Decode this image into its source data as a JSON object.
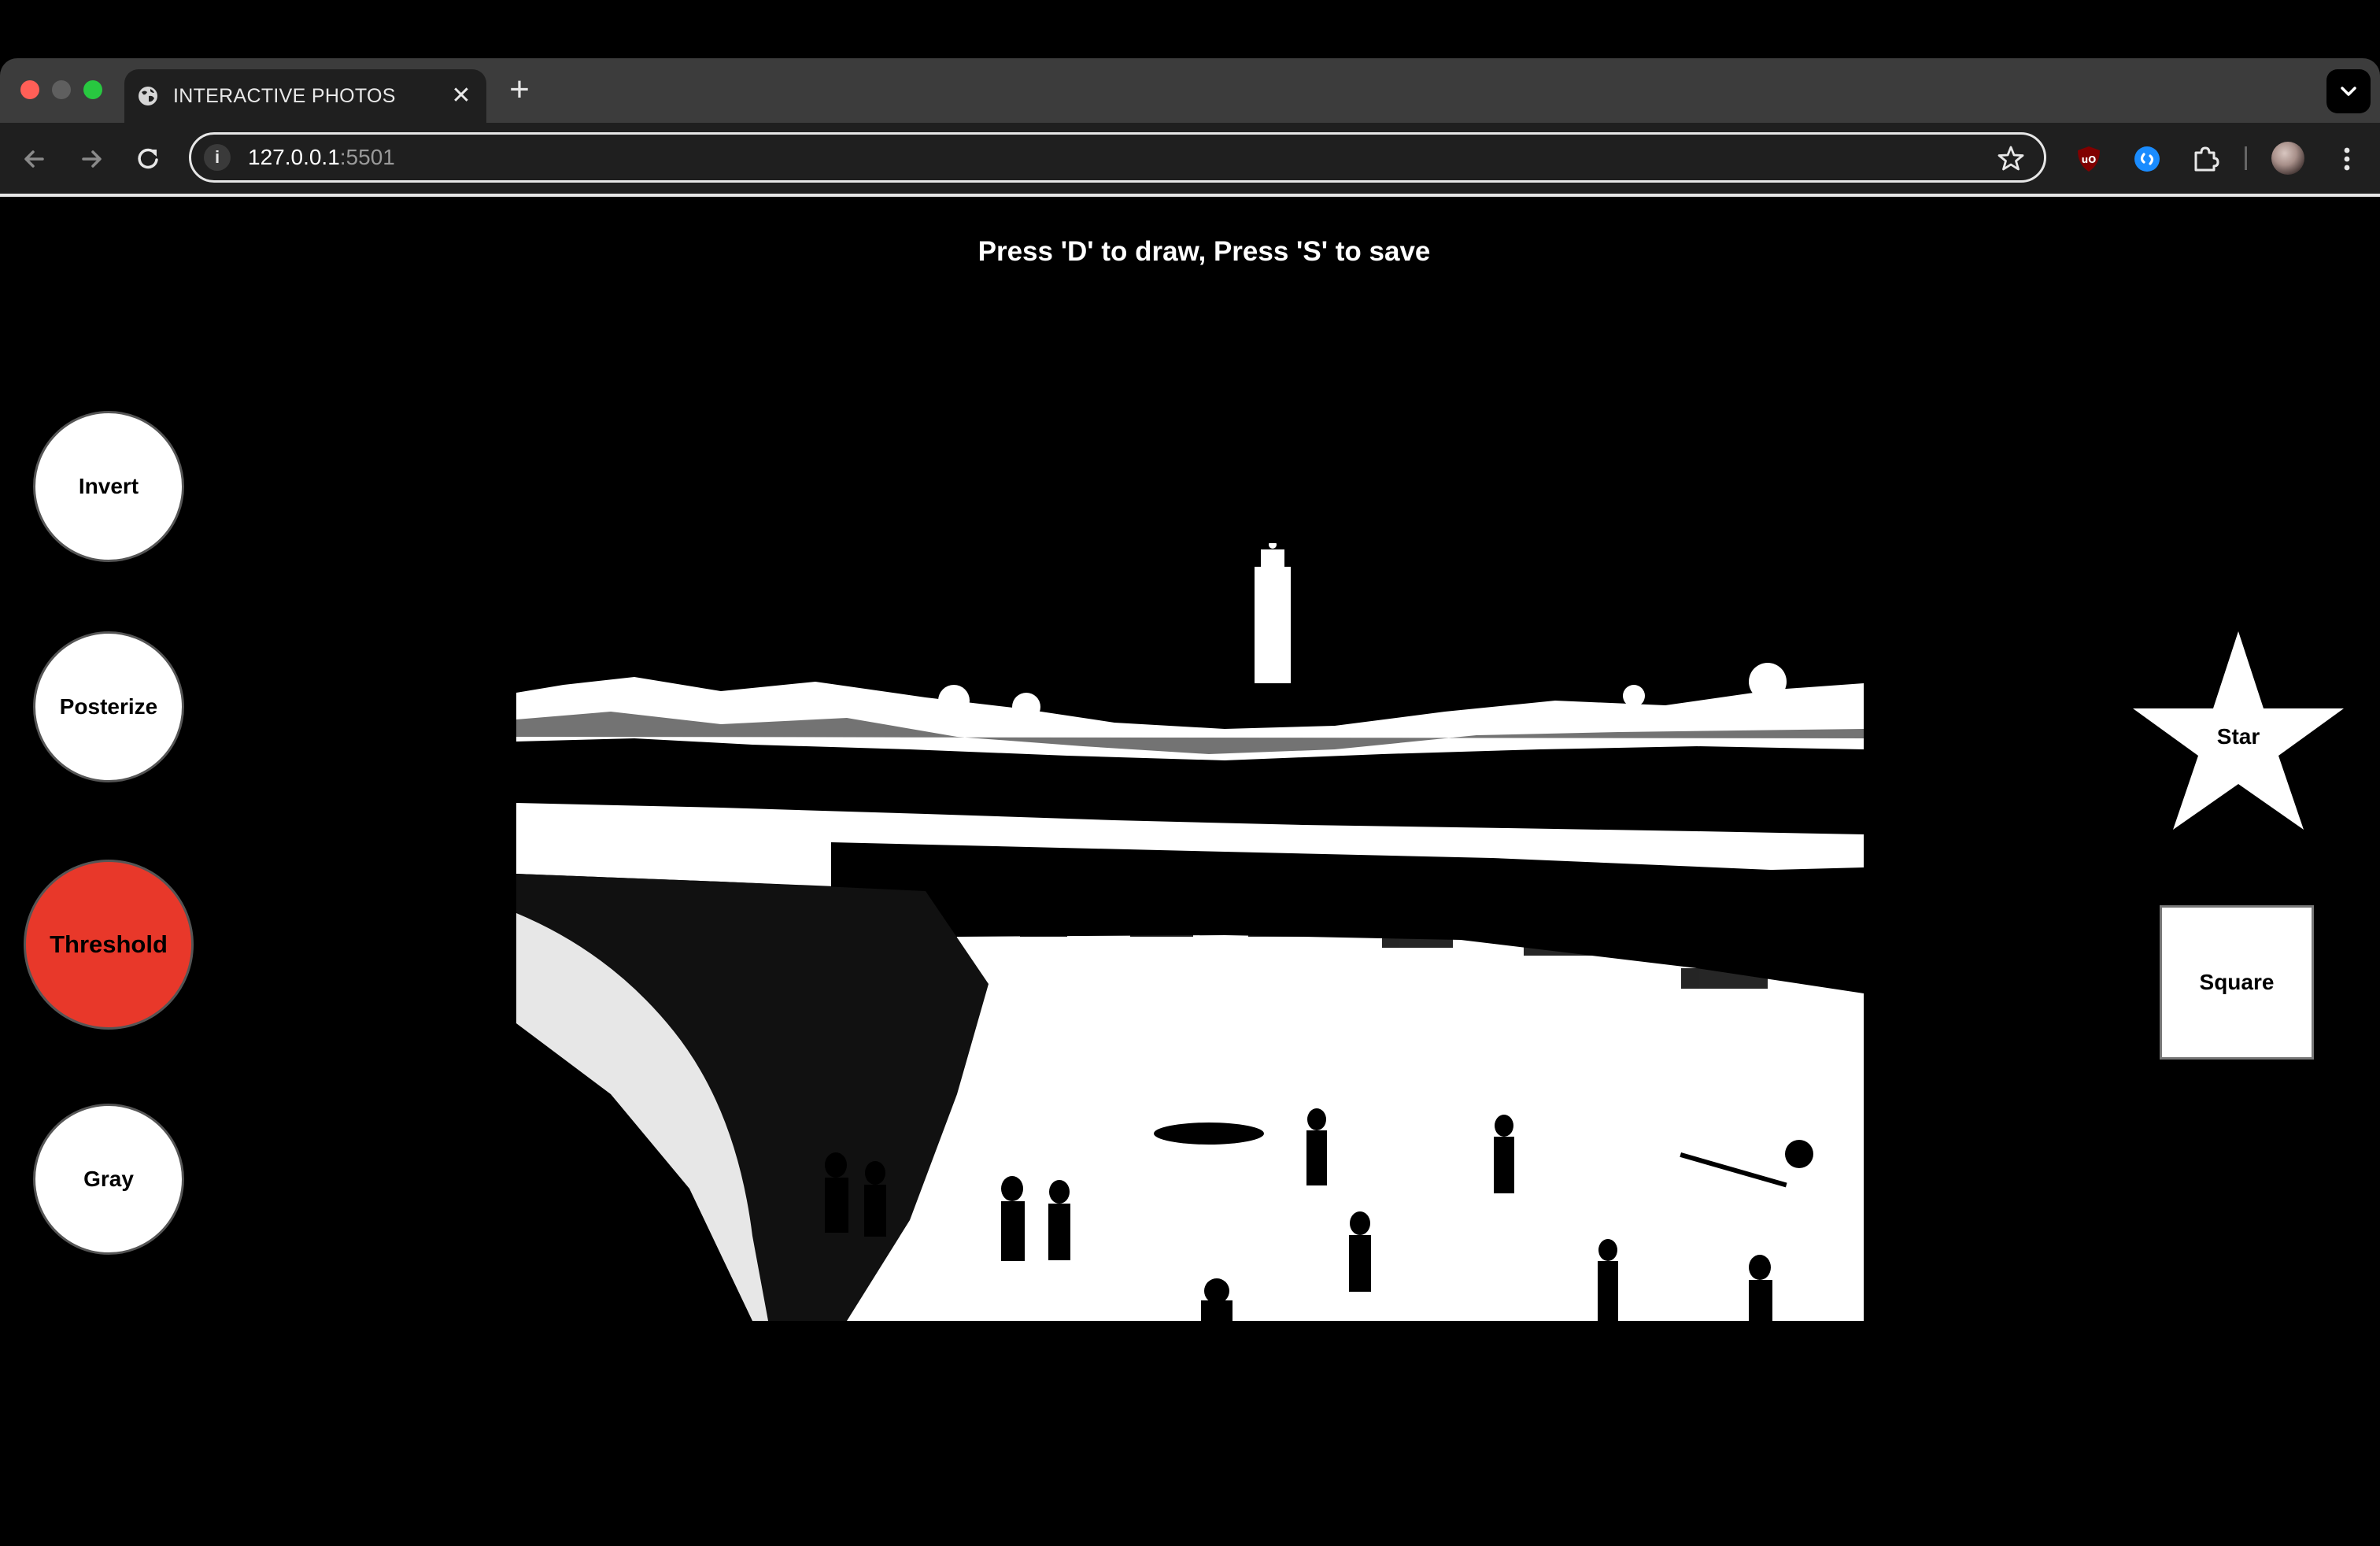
{
  "browser": {
    "tab_title": "INTERACTIVE PHOTOS",
    "close_glyph": "✕",
    "new_tab_glyph": "+",
    "url_host": "127.0.0.1",
    "url_port": ":5501",
    "site_info_glyph": "i"
  },
  "page": {
    "instruction": "Press 'D' to draw, Press 'S' to save"
  },
  "filters": {
    "invert": "Invert",
    "posterize": "Posterize",
    "threshold": "Threshold",
    "gray": "Gray",
    "active": "threshold"
  },
  "shapes": {
    "star": "Star",
    "square": "Square"
  },
  "colors": {
    "page_background": "#000000",
    "active_filter": "#e8382a",
    "button_fill": "#ffffff"
  },
  "photo": {
    "effect": "threshold"
  }
}
